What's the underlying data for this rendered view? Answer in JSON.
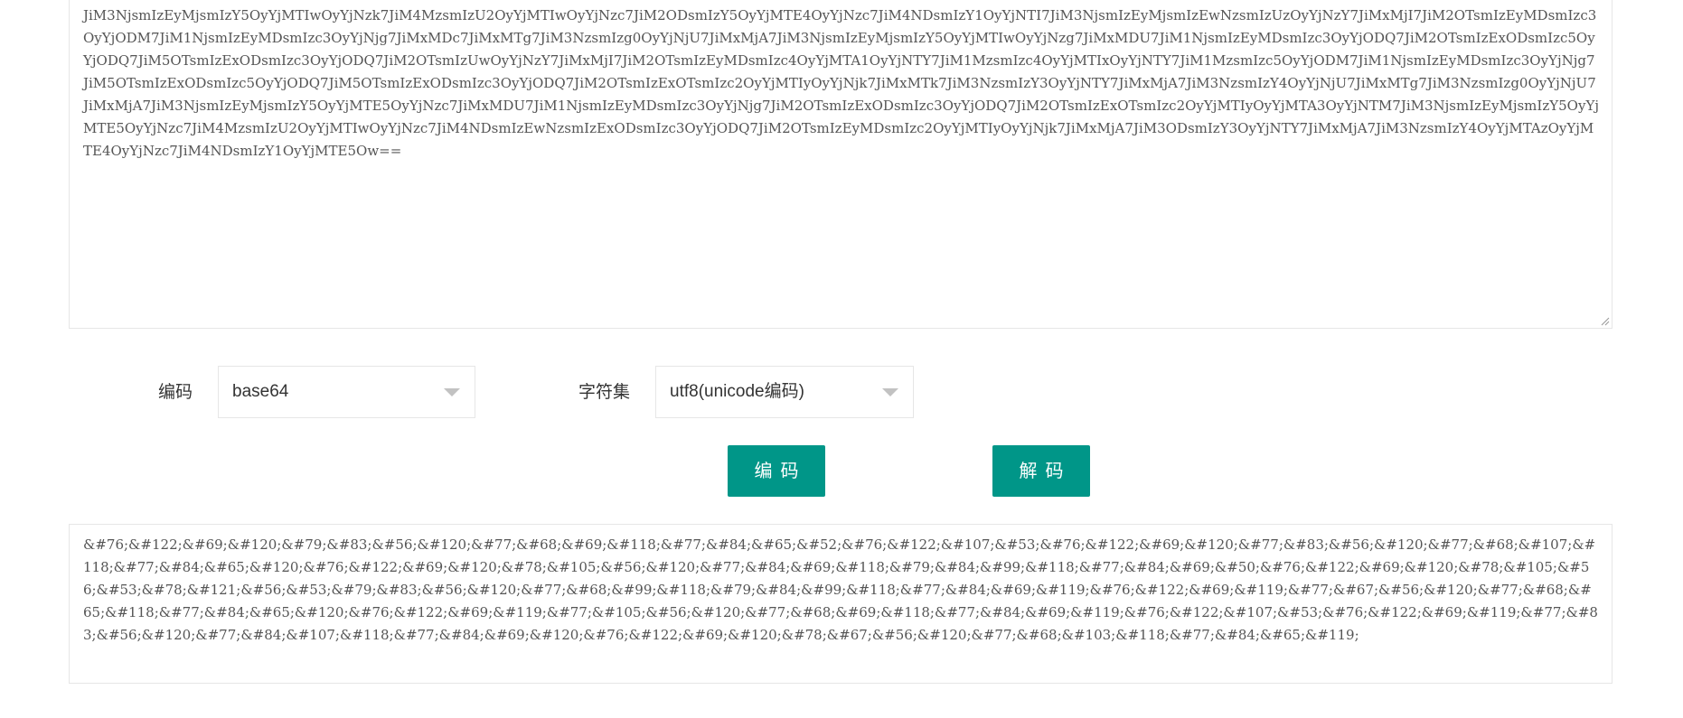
{
  "input": {
    "text": "JiM3NjsmIzEyMjsmIzY5OyYjMTIwOyYjNzk7JiM4MzsmIzU2OyYjMTIwOyYjNzc7JiM2ODsmIzY5OyYjMTE4OyYjNzc7JiM4NDsmIzY1OyYjNTI7JiM3NjsmIzEyMjsmIzEwNzsmIzUzOyYjNzY7JiMxMjI7JiM2OTsmIzEyMDsmIzc3OyYjODM7JiM1NjsmIzEyMDsmIzc3OyYjNjg7JiMxMDc7JiMxMTg7JiM3NzsmIzg0OyYjNjU7JiMxMjA7JiM3NjsmIzEyMjsmIzY5OyYjMTIwOyYjNzg7JiMxMDU7JiM1NjsmIzEyMDsmIzc3OyYjODQ7JiM2OTsmIzExODsmIzc5OyYjODQ7JiM5OTsmIzExODsmIzc3OyYjODQ7JiM2OTsmIzUwOyYjNzY7JiMxMjI7JiM2OTsmIzEyMDsmIzc4OyYjMTA1OyYjNTY7JiM1MzsmIzc4OyYjMTIxOyYjNTY7JiM1MzsmIzc5OyYjODM7JiM1NjsmIzEyMDsmIzc3OyYjNjg7JiM5OTsmIzExODsmIzc5OyYjODQ7JiM5OTsmIzExODsmIzc3OyYjODQ7JiM2OTsmIzExOTsmIzc2OyYjMTIyOyYjNjk7JiMxMTk7JiM3NzsmIzY3OyYjNTY7JiMxMjA7JiM3NzsmIzY4OyYjNjU7JiMxMTg7JiM3NzsmIzg0OyYjNjU7JiMxMjA7JiM3NjsmIzEyMjsmIzY5OyYjMTE5OyYjNzc7JiMxMDU7JiM1NjsmIzEyMDsmIzc3OyYjNjg7JiM2OTsmIzExODsmIzc3OyYjODQ7JiM2OTsmIzExOTsmIzc2OyYjMTIyOyYjMTA3OyYjNTM7JiM3NjsmIzEyMjsmIzY5OyYjMTE5OyYjNzc7JiM4MzsmIzU2OyYjMTIwOyYjNzc7JiM4NDsmIzEwNzsmIzExODsmIzc3OyYjODQ7JiM2OTsmIzEyMDsmIzc2OyYjMTIyOyYjNjk7JiMxMjA7JiM3ODsmIzY3OyYjNTY7JiMxMjA7JiM3NzsmIzY4OyYjMTAzOyYjMTE4OyYjNzc7JiM4NDsmIzY1OyYjMTE5Ow=="
  },
  "controls": {
    "encoding_label": "编码",
    "encoding_value": "base64",
    "charset_label": "字符集",
    "charset_value": "utf8(unicode编码)"
  },
  "buttons": {
    "encode": "编码",
    "decode": "解码"
  },
  "output": {
    "text": "&#76;&#122;&#69;&#120;&#79;&#83;&#56;&#120;&#77;&#68;&#69;&#118;&#77;&#84;&#65;&#52;&#76;&#122;&#107;&#53;&#76;&#122;&#69;&#120;&#77;&#83;&#56;&#120;&#77;&#68;&#107;&#118;&#77;&#84;&#65;&#120;&#76;&#122;&#69;&#120;&#78;&#105;&#56;&#120;&#77;&#84;&#69;&#118;&#79;&#84;&#99;&#118;&#77;&#84;&#69;&#50;&#76;&#122;&#69;&#120;&#78;&#105;&#56;&#53;&#78;&#121;&#56;&#53;&#79;&#83;&#56;&#120;&#77;&#68;&#99;&#118;&#79;&#84;&#99;&#118;&#77;&#84;&#69;&#119;&#76;&#122;&#69;&#119;&#77;&#67;&#56;&#120;&#77;&#68;&#65;&#118;&#77;&#84;&#65;&#120;&#76;&#122;&#69;&#119;&#77;&#105;&#56;&#120;&#77;&#68;&#69;&#118;&#77;&#84;&#69;&#119;&#76;&#122;&#107;&#53;&#76;&#122;&#69;&#119;&#77;&#83;&#56;&#120;&#77;&#84;&#107;&#118;&#77;&#84;&#69;&#120;&#76;&#122;&#69;&#120;&#78;&#67;&#56;&#120;&#77;&#68;&#103;&#118;&#77;&#84;&#65;&#119;"
  },
  "colors": {
    "primary_button": "#009688",
    "border": "#e6e6e6",
    "text": "#333333",
    "muted_text": "#555555",
    "caret": "#c2c2c2"
  }
}
